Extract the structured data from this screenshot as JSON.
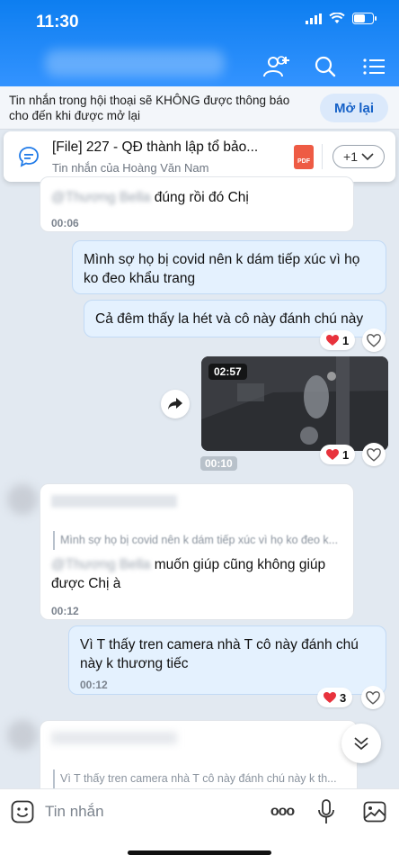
{
  "status_bar": {
    "time": "11:30"
  },
  "header": {
    "icons": [
      "add-member-icon",
      "search-icon",
      "menu-icon"
    ]
  },
  "notice": {
    "text": "Tin nhắn trong hội thoại sẽ KHÔNG được thông báo cho đến khi được mở lại",
    "button": "Mở lại"
  },
  "pinned": {
    "title": "[File] 227 - QĐ thành lập tổ bảo...",
    "subtitle": "Tin nhắn của Hoàng Văn Nam",
    "file_badge": "PDF",
    "more_label": "+1"
  },
  "messages": {
    "m1": {
      "text": "đúng rồi đó Chị",
      "time": "00:06"
    },
    "m2": {
      "text": "Mình sợ họ bị covid nên k dám tiếp xúc vì họ ko đeo khẩu trang"
    },
    "m3": {
      "text": "Cả đêm thấy la hét và cô này đánh chú này",
      "reaction_count": "1"
    },
    "video": {
      "duration": "02:57",
      "reaction_count": "1",
      "time": "00:10"
    },
    "m4": {
      "quote": "Mình sợ họ bị covid nên k dám tiếp xúc vì họ ko đeo k...",
      "text": "muốn giúp cũng không giúp được Chị à",
      "time": "00:12"
    },
    "m5": {
      "text": "Vì T thấy tren camera nhà T cô này đánh chú này k thương tiếc",
      "time": "00:12",
      "reaction_count": "3"
    },
    "m6": {
      "quote": "Vì T thấy tren camera nhà T cô này đánh chú này k th..."
    }
  },
  "input": {
    "placeholder": "Tin nhắn",
    "more_label": "ooo"
  }
}
